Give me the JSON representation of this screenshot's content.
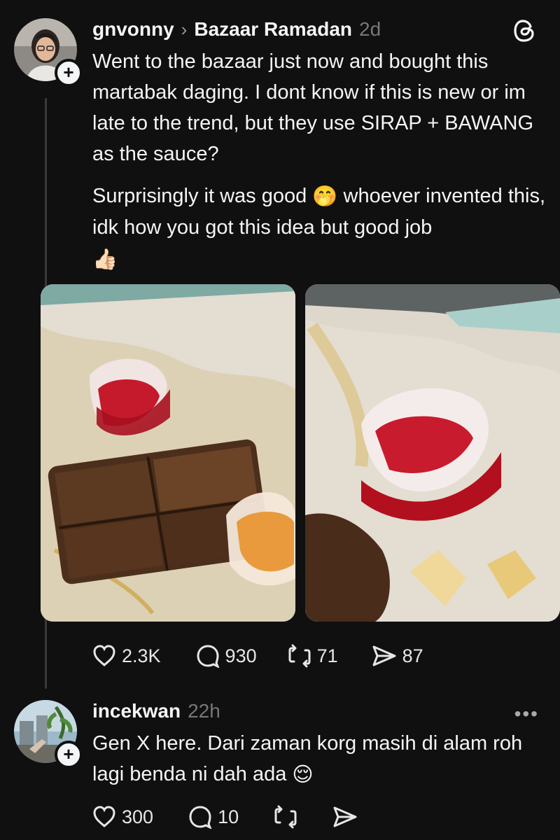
{
  "post": {
    "username": "gnvonny",
    "separator": "›",
    "community": "Bazaar Ramadan",
    "time": "2d",
    "paragraph_1": "Went to the bazaar just now and bought this martabak daging. I dont know if this is new or im late to the trend, but they use SIRAP + BAWANG as the sauce?",
    "paragraph_2_a": "Surprisingly it was good ",
    "emoji_1": "🤭",
    "paragraph_2_b": " whoever invented this, idk how you got this idea but good job ",
    "emoji_2": "👍🏻",
    "likes": "2.3K",
    "comments": "930",
    "reposts": "71",
    "shares": "87"
  },
  "reply": {
    "username": "incekwan",
    "time": "22h",
    "text_a": "Gen X here. Dari zaman korg masih di alam roh lagi benda ni dah ada ",
    "emoji": "😌",
    "likes": "300",
    "comments": "10",
    "more": "•••"
  },
  "follow_symbol": "+",
  "icons": [
    "threads-logo-icon",
    "heart-icon",
    "comment-icon",
    "repost-icon",
    "share-icon",
    "more-icon"
  ],
  "colors": {
    "background": "#101010",
    "text": "#f3f5f7",
    "muted": "#777777",
    "thread_line": "#3a3a3a"
  }
}
